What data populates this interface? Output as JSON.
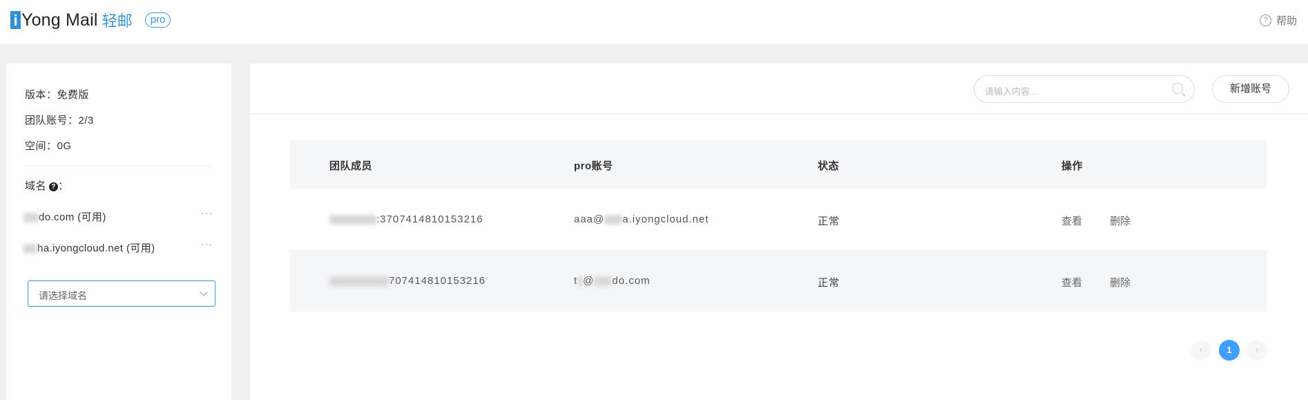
{
  "header": {
    "logo_i": "i",
    "logo_name": "Yong Mail",
    "logo_cn": "轻邮",
    "logo_badge": "pro",
    "help_label": "帮助"
  },
  "sidebar": {
    "version": "版本：免费版",
    "team_accounts": "团队账号：2/3",
    "storage": "空间：0G",
    "domain_label": "域名",
    "domain_colon": "：",
    "domains": [
      {
        "name": "do.com (可用)",
        "more": "···"
      },
      {
        "name": "ha.iyongcloud.net (可用)",
        "more": "···"
      }
    ],
    "select_placeholder": "请选择域名"
  },
  "toolbar": {
    "search_placeholder": "请输入内容...",
    "add_label": "新增账号"
  },
  "table": {
    "headers": [
      "团队成员",
      "pro账号",
      "状态",
      "操作"
    ],
    "rows": [
      {
        "member": ":3707414810153216",
        "account_prefix": "aaa@",
        "account_suffix": "a.iyongcloud.net",
        "status": "正常",
        "view": "查看",
        "delete": "删除"
      },
      {
        "member": "707414810153216",
        "account_prefix": "t",
        "account_mid": "@",
        "account_suffix": "do.com",
        "status": "正常",
        "view": "查看",
        "delete": "删除"
      }
    ]
  },
  "pagination": {
    "prev": "‹",
    "current": "1",
    "next": "›"
  }
}
